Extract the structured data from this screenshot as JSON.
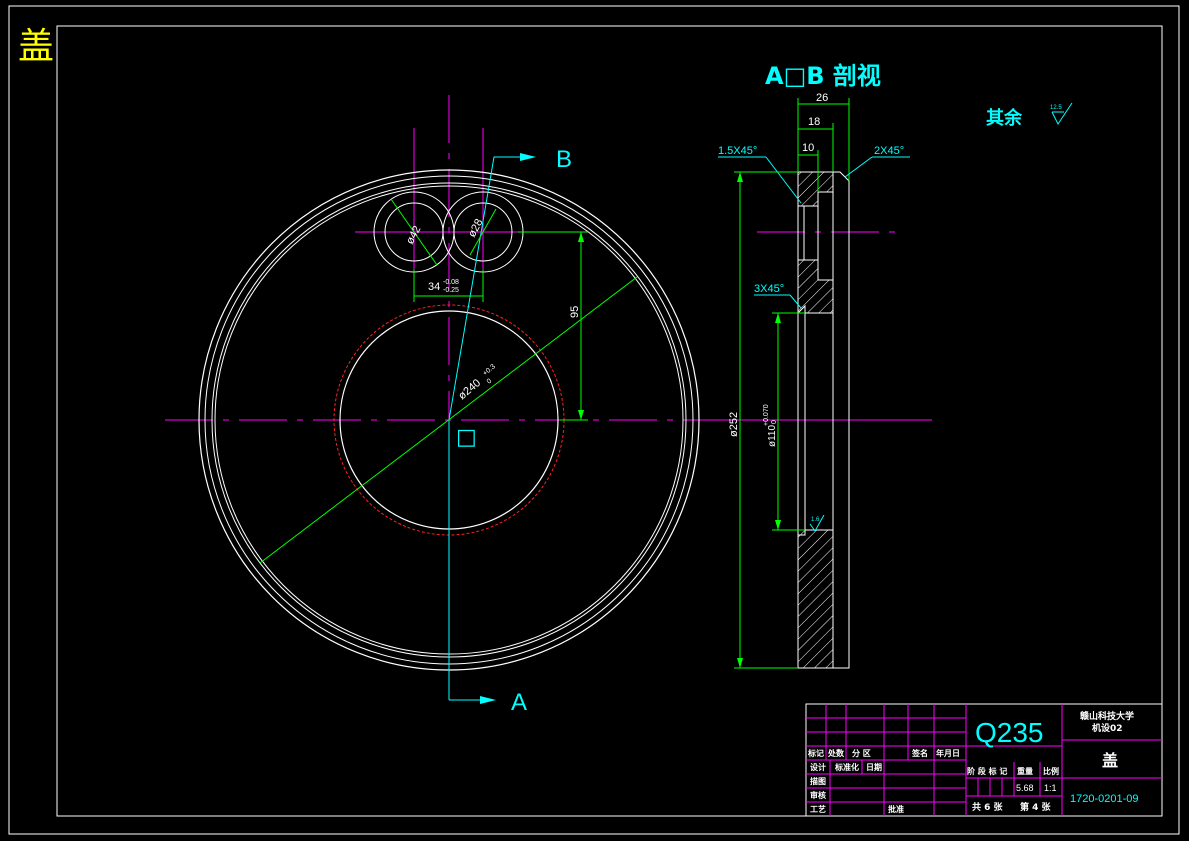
{
  "part_mark": "盖",
  "section_title": "A□B 剖视",
  "rough_note": "其余",
  "rough_value": "12.5",
  "rough_value_small": "1.6",
  "section_labels": {
    "a": "A",
    "b": "B"
  },
  "center_mark": "□",
  "front_view": {
    "dim_hole_big": "ø42",
    "dim_hole_small": "ø28",
    "dim_spacing": "34",
    "dim_spacing_tol_upper": "-0.08",
    "dim_spacing_tol_lower": "-0.25",
    "dim_offset": "95",
    "dim_diameter": "ø240",
    "dim_diameter_tol": "+0.3",
    "dim_diameter_tol_lower": "0"
  },
  "side_view": {
    "dim_width_total": "26",
    "dim_width_mid": "18",
    "dim_width_inner": "10",
    "chamfer_1": "1.5X45°",
    "chamfer_2": "2X45°",
    "chamfer_3": "3X45°",
    "dim_outer_diameter": "ø252",
    "dim_bore": "ø110",
    "dim_bore_tol_upper": "+0.070",
    "dim_bore_tol_lower": "0"
  },
  "title_block": {
    "material": "Q235",
    "school": "赣山科技大学",
    "class_name": "机设02",
    "part_name": "盖",
    "drawing_no": "1720-0201-09",
    "row_headers": [
      "标记",
      "处数",
      "分 区",
      "签名",
      "年月日"
    ],
    "role_rows": [
      "设计",
      "标准化",
      "日期"
    ],
    "check_rows": [
      "描图",
      "审核",
      "工艺",
      "批准"
    ],
    "stage_headers": [
      "阶 段 标 记",
      "重量",
      "比例"
    ],
    "weight": "5.68",
    "scale": "1:1",
    "sheet_total": "共 6 张",
    "sheet_current": "第 4 张"
  }
}
